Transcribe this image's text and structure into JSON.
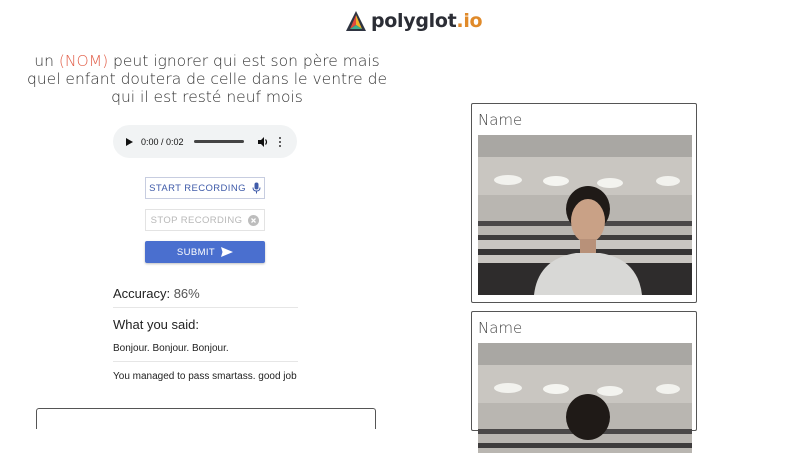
{
  "brand": {
    "name": "polyglot",
    "tld": ".io"
  },
  "prompt": {
    "before": "un ",
    "highlight": "(NOM)",
    "after": " peut ignorer qui est son père mais quel enfant doutera de celle dans le ventre de qui il est resté neuf mois"
  },
  "audio": {
    "time": "0:00 / 0:02"
  },
  "buttons": {
    "start": "START RECORDING",
    "stop": "STOP RECORDING",
    "submit": "SUBMIT"
  },
  "results": {
    "accuracy_label": "Accuracy:",
    "accuracy_value": "86%",
    "said_heading": "What you said:",
    "said_text": "Bonjour. Bonjour. Bonjour.",
    "feedback": "You managed to pass smartass. good job"
  },
  "video_cards": [
    {
      "name": "Name"
    },
    {
      "name": "Name"
    }
  ],
  "icons": [
    "polyglot-logo-icon",
    "play-icon",
    "volume-icon",
    "more-vert-icon",
    "mic-icon",
    "cancel-icon",
    "send-icon"
  ],
  "colors": {
    "accent": "#4a6fcf",
    "highlight": "#e2604a",
    "logo_dot": "#e08a2a"
  }
}
